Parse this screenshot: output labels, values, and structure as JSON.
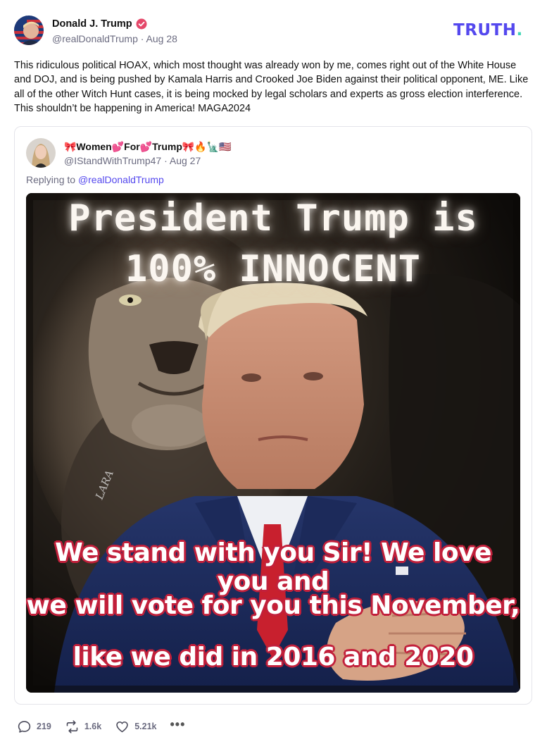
{
  "author": {
    "name": "Donald J. Trump",
    "handle": "@realDonaldTrump",
    "date": "Aug 28"
  },
  "brand": {
    "logo_text": "TRUTH",
    "logo_dot": "."
  },
  "post": {
    "text": "This ridiculous political HOAX, which most thought was already won by me, comes right out of the White House and DOJ, and is being pushed by Kamala Harris and Crooked Joe Biden against their political opponent, ME. Like all of the other Witch Hunt cases, it is being mocked by legal scholars and experts as gross election interference. This shouldn’t be happening in America! MAGA2024"
  },
  "quote": {
    "name": "🎀Women💕For💕Trump🎀🔥🗽🇺🇸",
    "handle": "@IStandWithTrump47",
    "date": "Aug 27",
    "reply_prefix": "Replying to",
    "reply_to": "@realDonaldTrump",
    "image": {
      "headline_line1": "President Trump is",
      "headline_line2": "100% INNOCENT",
      "caption_line1": "We stand with you Sir! We love you and",
      "caption_line2": "we will vote for you this November,",
      "caption_line3": "like we did in 2016 and 2020",
      "signature": "LARA"
    }
  },
  "actions": {
    "replies": "219",
    "retruths": "1.6k",
    "likes": "5.21k",
    "more": "•••"
  },
  "colors": {
    "brand": "#5448ee",
    "brand_dot": "#3ed6b5",
    "verified": "#e5486a",
    "caption_outline": "#c2213c"
  }
}
